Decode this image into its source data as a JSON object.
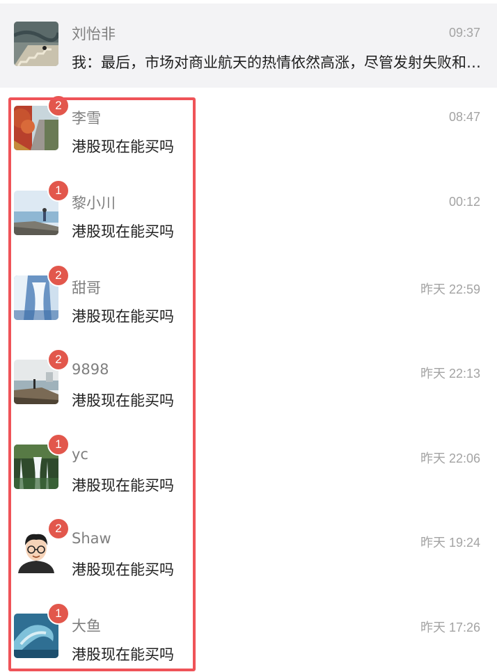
{
  "conversations": [
    {
      "name": "刘怡非",
      "time": "09:37",
      "preview": "我：最后，市场对商业航天的热情依然高涨，尽管发射失败和亏损持续，商业航天仍在快速发展",
      "badge": "",
      "avatar_icon": "staircase-photo-icon"
    },
    {
      "name": "李雪",
      "time": "08:47",
      "preview": "港股现在能买吗",
      "badge": "2",
      "avatar_icon": "autumn-path-photo-icon"
    },
    {
      "name": "黎小川",
      "time": "00:12",
      "preview": "港股现在能买吗",
      "badge": "1",
      "avatar_icon": "seaside-person-photo-icon"
    },
    {
      "name": "甜哥",
      "time": "昨天 22:59",
      "preview": "港股现在能买吗",
      "badge": "2",
      "avatar_icon": "frozen-waterfall-photo-icon"
    },
    {
      "name": "9898",
      "time": "昨天 22:13",
      "preview": "港股现在能买吗",
      "badge": "2",
      "avatar_icon": "rocky-coast-photo-icon"
    },
    {
      "name": "yc",
      "time": "昨天 22:06",
      "preview": "港股现在能买吗",
      "badge": "1",
      "avatar_icon": "forest-waterfall-photo-icon"
    },
    {
      "name": "Shaw",
      "time": "昨天 19:24",
      "preview": "港股现在能买吗",
      "badge": "2",
      "avatar_icon": "cartoon-man-glasses-icon"
    },
    {
      "name": "大鱼",
      "time": "昨天 17:26",
      "preview": "港股现在能买吗",
      "badge": "1",
      "avatar_icon": "ocean-wave-photo-icon"
    }
  ],
  "colors": {
    "badge": "#e2574c",
    "highlight": "#ef5358",
    "pinned_bg": "#f3f3f5"
  }
}
